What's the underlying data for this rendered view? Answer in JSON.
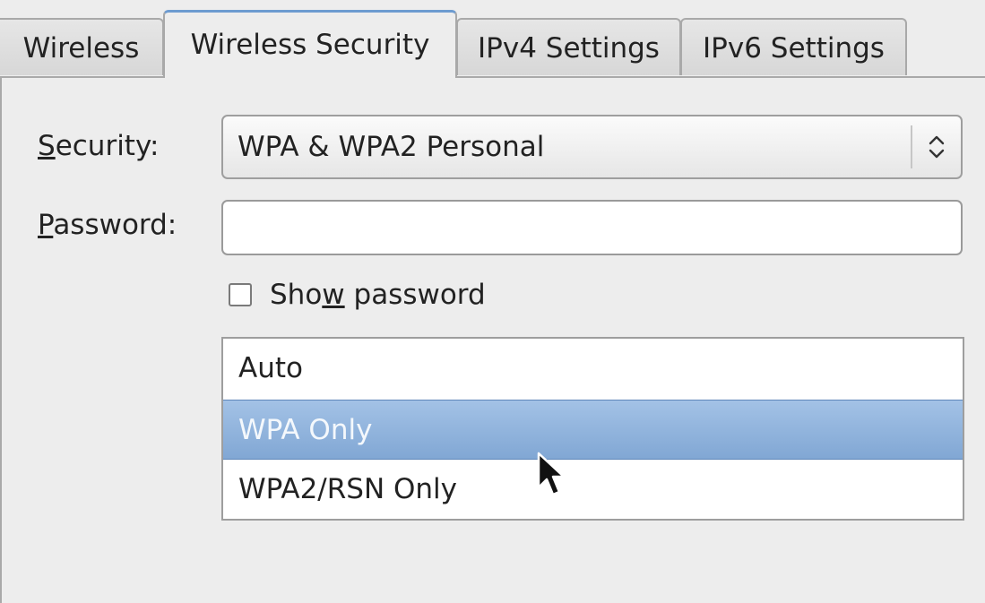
{
  "tabs": [
    {
      "label": "Wireless",
      "active": false
    },
    {
      "label": "Wireless Security",
      "active": true
    },
    {
      "label": "IPv4 Settings",
      "active": false
    },
    {
      "label": "IPv6 Settings",
      "active": false
    }
  ],
  "security": {
    "label_mnemonic": "S",
    "label_rest": "ecurity:",
    "selected_value": "WPA & WPA2 Personal",
    "icon": "updown-arrows-icon"
  },
  "password": {
    "label_mnemonic": "P",
    "label_rest": "assword:",
    "value": "",
    "placeholder": ""
  },
  "show_password": {
    "label_before": "Sho",
    "label_mnemonic": "w",
    "label_after": " password",
    "checked": false
  },
  "list": {
    "items": [
      "Auto",
      "WPA Only",
      "WPA2/RSN Only"
    ],
    "selected_index": 1
  },
  "colors": {
    "selection": "#8fb2db",
    "active_tab_accent": "#6d9bd0",
    "background": "#ededed"
  },
  "pointer_icon": "mouse-pointer-icon"
}
